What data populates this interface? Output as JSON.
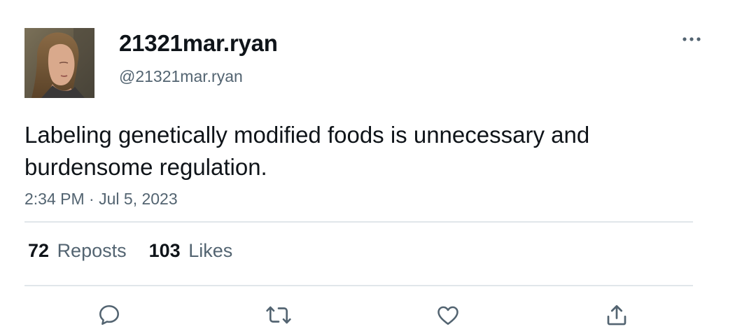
{
  "tweet": {
    "display_name": "21321mar.ryan",
    "handle": "@21321mar.ryan",
    "text": "Labeling genetically modified foods is unnecessary and burdensome regulation.",
    "time": "2:34 PM",
    "separator": "·",
    "date": "Jul 5, 2023"
  },
  "stats": {
    "reposts_count": "72",
    "reposts_label": "Reposts",
    "likes_count": "103",
    "likes_label": "Likes"
  },
  "icons": {
    "more": "more-horizontal-icon",
    "reply": "reply-icon",
    "repost": "repost-icon",
    "like": "heart-icon",
    "share": "share-icon"
  },
  "colors": {
    "text": "#0f1419",
    "secondary": "#536471",
    "divider": "#e1e6ea"
  }
}
